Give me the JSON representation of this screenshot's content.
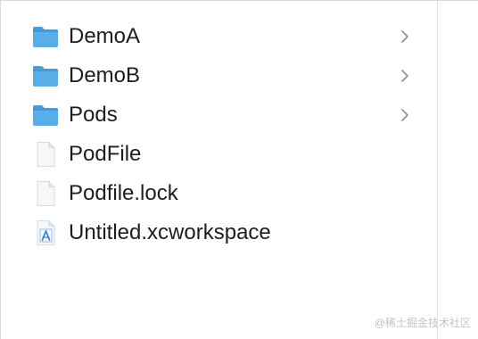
{
  "files": [
    {
      "name": "DemoA",
      "type": "folder",
      "icon": "folder-icon",
      "has_children": true
    },
    {
      "name": "DemoB",
      "type": "folder",
      "icon": "folder-icon",
      "has_children": true
    },
    {
      "name": "Pods",
      "type": "folder",
      "icon": "folder-icon",
      "has_children": true
    },
    {
      "name": "PodFile",
      "type": "file",
      "icon": "document-icon",
      "has_children": false
    },
    {
      "name": "Podfile.lock",
      "type": "file",
      "icon": "document-icon",
      "has_children": false
    },
    {
      "name": "Untitled.xcworkspace",
      "type": "workspace",
      "icon": "xcode-workspace-icon",
      "has_children": false
    }
  ],
  "watermark": "@稀土掘金技术社区",
  "colors": {
    "folder_body": "#5aaee8",
    "folder_tab": "#4a9ad9",
    "text": "#1d1d1f",
    "chevron": "#8e8e93"
  }
}
